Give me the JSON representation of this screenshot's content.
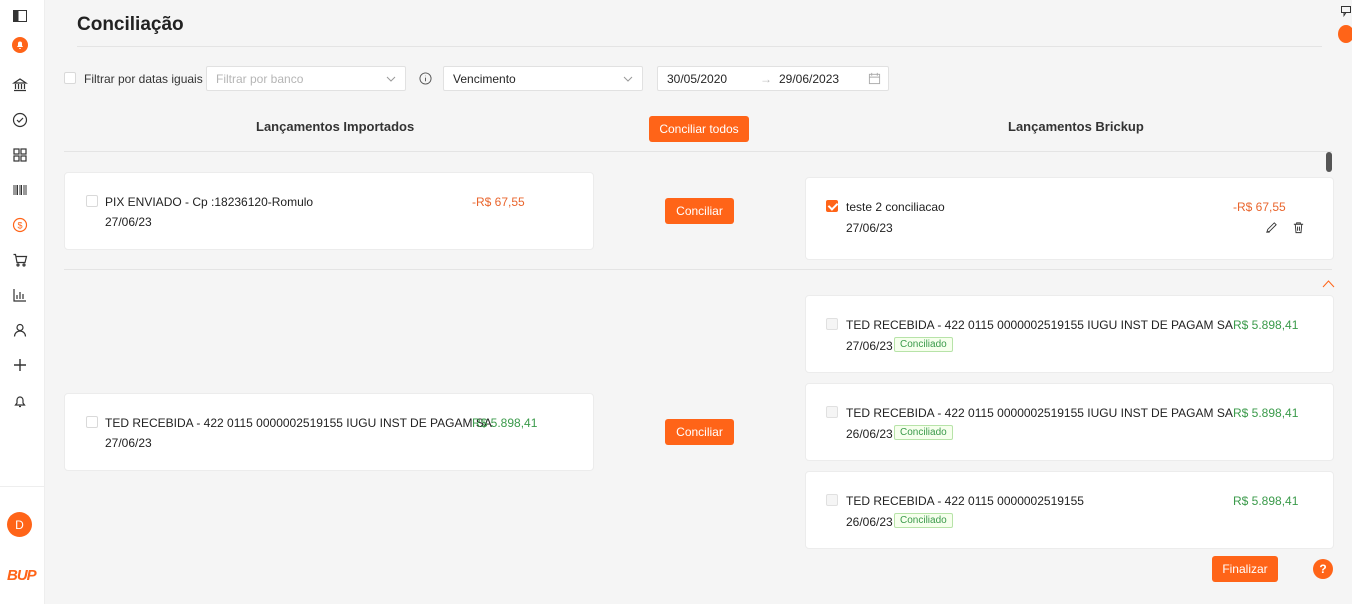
{
  "colors": {
    "accent": "#ff6418",
    "negative": "#e9652d",
    "positive": "#3a9a4a"
  },
  "sidebar": {
    "icons": [
      "panel-toggle-icon",
      "brand-bell-icon",
      "bank-icon",
      "check-circle-icon",
      "grid-icon",
      "barcode-icon",
      "dollar-circle-icon",
      "cart-icon",
      "bar-chart-icon",
      "user-icon",
      "plus-icon",
      "bell-icon"
    ],
    "active": "dollar-circle-icon",
    "avatar_initial": "D",
    "logo": "BUP"
  },
  "page": {
    "title": "Conciliação"
  },
  "filters": {
    "same_dates_label": "Filtrar por datas iguais",
    "bank_placeholder": "Filtrar por banco",
    "date_type_value": "Vencimento",
    "date_start": "30/05/2020",
    "date_end": "29/06/2023",
    "arrow": "→"
  },
  "columns": {
    "imported_title": "Lançamentos Importados",
    "brickup_title": "Lançamentos Brickup",
    "conciliate_all_label": "Conciliar todos"
  },
  "groups": [
    {
      "imported": {
        "description": "PIX ENVIADO - Cp :18236120-Romulo",
        "date": "27/06/23",
        "amount": "-R$ 67,55"
      },
      "conciliate_label": "Conciliar",
      "brickup": [
        {
          "description": "teste 2 conciliacao",
          "date": "27/06/23",
          "amount": "-R$ 67,55",
          "checked": true
        }
      ]
    },
    {
      "imported": {
        "description": "TED RECEBIDA - 422 0115 0000002519155 IUGU INST DE PAGAM SA",
        "date": "27/06/23",
        "amount": "R$ 5.898,41"
      },
      "conciliate_label": "Conciliar",
      "brickup": [
        {
          "description": "TED RECEBIDA - 422 0115 0000002519155 IUGU INST DE PAGAM SA",
          "date": "27/06/23",
          "amount": "R$ 5.898,41",
          "status": "Conciliado"
        },
        {
          "description": "TED RECEBIDA - 422 0115 0000002519155 IUGU INST DE PAGAM SA",
          "date": "26/06/23",
          "amount": "R$ 5.898,41",
          "status": "Conciliado"
        },
        {
          "description": "TED RECEBIDA - 422 0115 0000002519155",
          "date": "26/06/23",
          "amount": "R$ 5.898,41",
          "status": "Conciliado"
        }
      ]
    }
  ],
  "footer": {
    "finish_label": "Finalizar",
    "help_glyph": "?"
  }
}
